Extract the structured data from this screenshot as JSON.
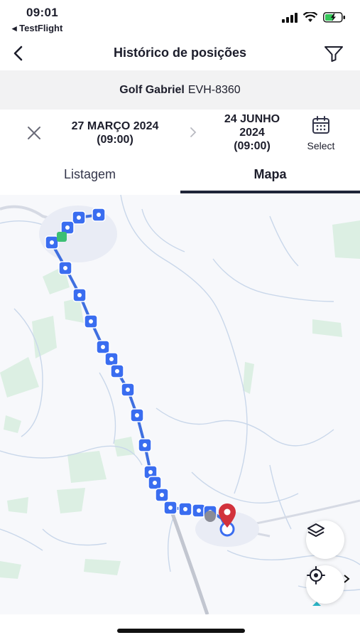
{
  "status_bar": {
    "time": "09:01",
    "back_app": "◂ TestFlight"
  },
  "header": {
    "title": "Histórico de posições"
  },
  "vehicle": {
    "name": "Golf Gabriel",
    "plate": "EVH-8360"
  },
  "dates": {
    "start_line1": "27 MARÇO 2024",
    "start_line2": "(09:00)",
    "end_line1": "24 JUNHO",
    "end_line2": "2024",
    "end_line3": "(09:00)",
    "select_label": "Select"
  },
  "tabs": {
    "list": "Listagem",
    "map": "Mapa",
    "active": "map"
  },
  "colors": {
    "route": "#3f6fe0",
    "marker": "#3a6df0",
    "destination_pin": "#d2323c",
    "tab_underline": "#1f2438"
  },
  "map_controls": [
    "layers-icon",
    "locate-icon"
  ]
}
